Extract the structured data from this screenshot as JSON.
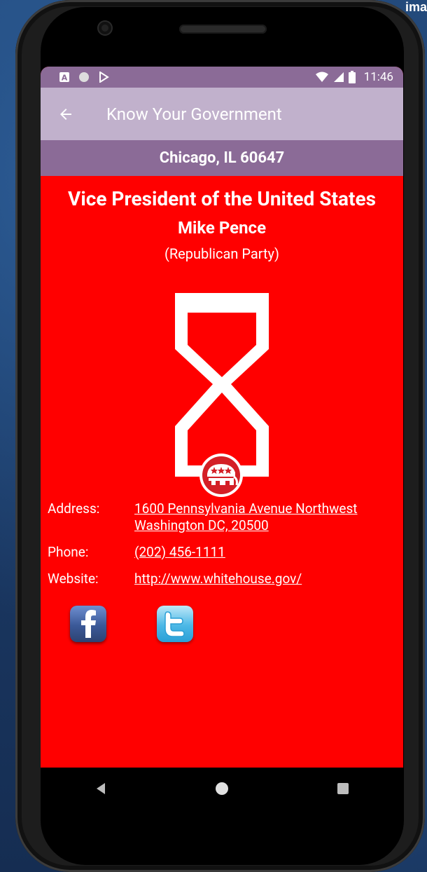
{
  "backdrop": {
    "corner_text": "ima"
  },
  "status_bar": {
    "time": "11:46"
  },
  "app_bar": {
    "title": "Know Your Government"
  },
  "location": {
    "text": "Chicago, IL 60647"
  },
  "official": {
    "office": "Vice President of the United States",
    "name": "Mike Pence",
    "party": "(Republican Party)"
  },
  "details": {
    "address_label": "Address:",
    "address_line1": "1600 Pennsylvania Avenue Northwest",
    "address_line2": "Washington DC, 20500",
    "phone_label": "Phone:",
    "phone": "(202) 456-1111",
    "website_label": "Website:",
    "website": "http://www.whitehouse.gov/"
  },
  "colors": {
    "background": "#ff0000",
    "status_bar": "#8b6b97",
    "app_bar": "#c1b1cc",
    "location_bar": "#8b6b97"
  },
  "icons": [
    "back-arrow-icon",
    "facebook-icon",
    "twitter-icon",
    "republican-elephant-icon",
    "nav-back-icon",
    "nav-home-icon",
    "nav-recents-icon"
  ]
}
